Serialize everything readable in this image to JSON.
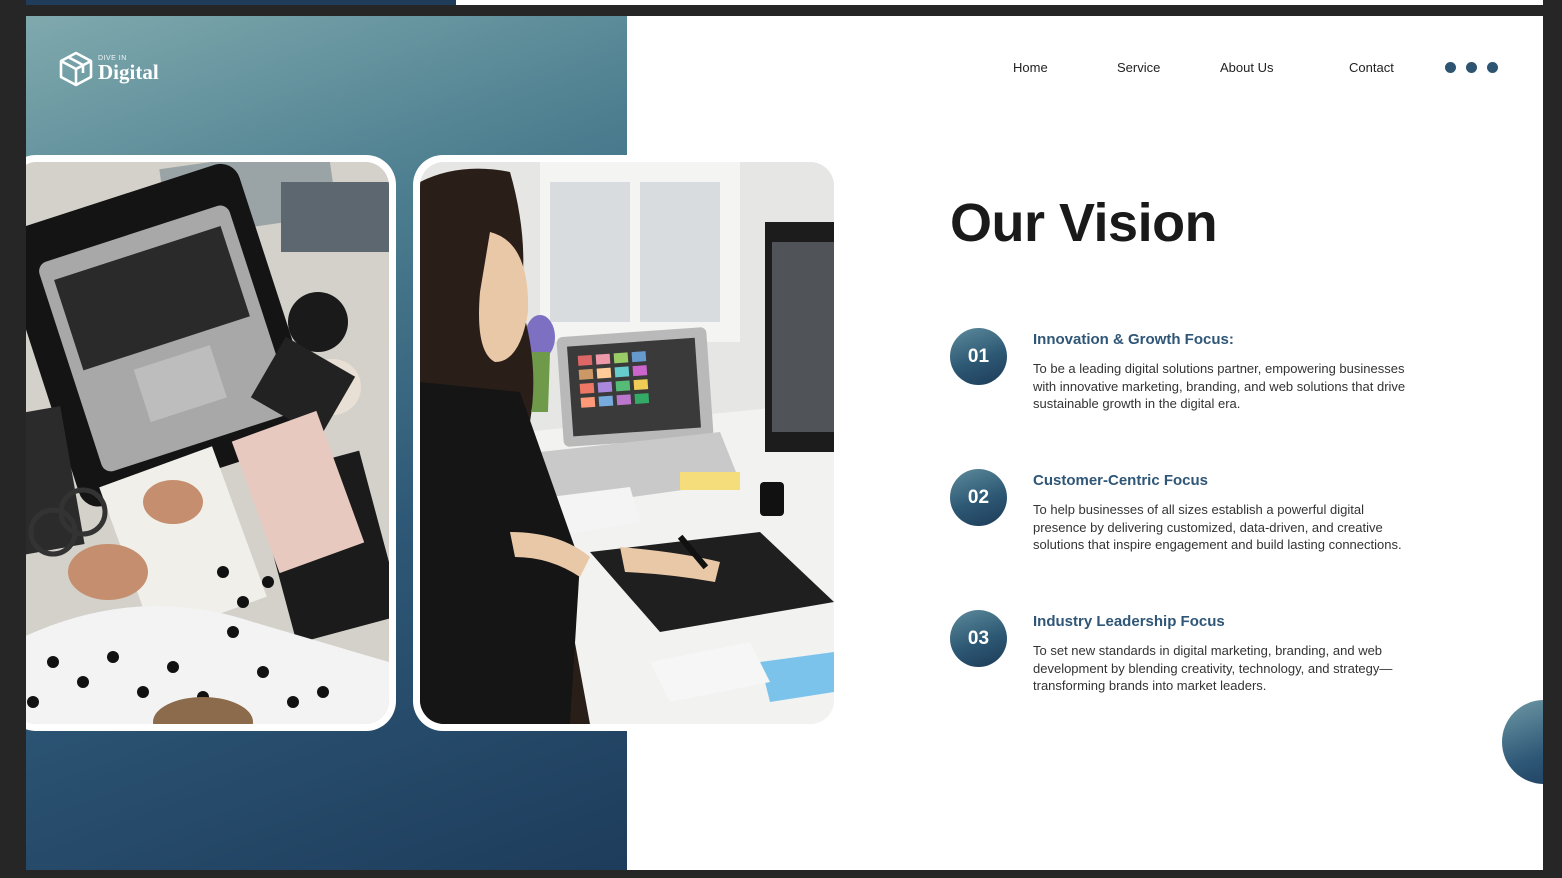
{
  "logo": {
    "small": "DIVE IN",
    "big": "Digital"
  },
  "nav": {
    "home": "Home",
    "service": "Service",
    "about": "About Us",
    "contact": "Contact"
  },
  "title": "Our Vision",
  "items": [
    {
      "number": "01",
      "heading": "Innovation & Growth Focus:",
      "body": "To be a leading digital solutions partner, empowering businesses with innovative marketing, branding, and web solutions that drive sustainable growth in the digital era."
    },
    {
      "number": "02",
      "heading": "Customer-Centric Focus",
      "body": "To help businesses of all sizes establish a powerful digital presence by delivering customized, data-driven, and creative solutions that inspire engagement and build lasting connections."
    },
    {
      "number": "03",
      "heading": "Industry Leadership Focus",
      "body": "To set new standards in digital marketing, branding, and web development by blending creativity, technology, and strategy—transforming brands into market leaders."
    }
  ],
  "colors": {
    "accent": "#2f5677",
    "panel_dark": "#1e3c5c",
    "panel_light": "#7fa9ad"
  }
}
